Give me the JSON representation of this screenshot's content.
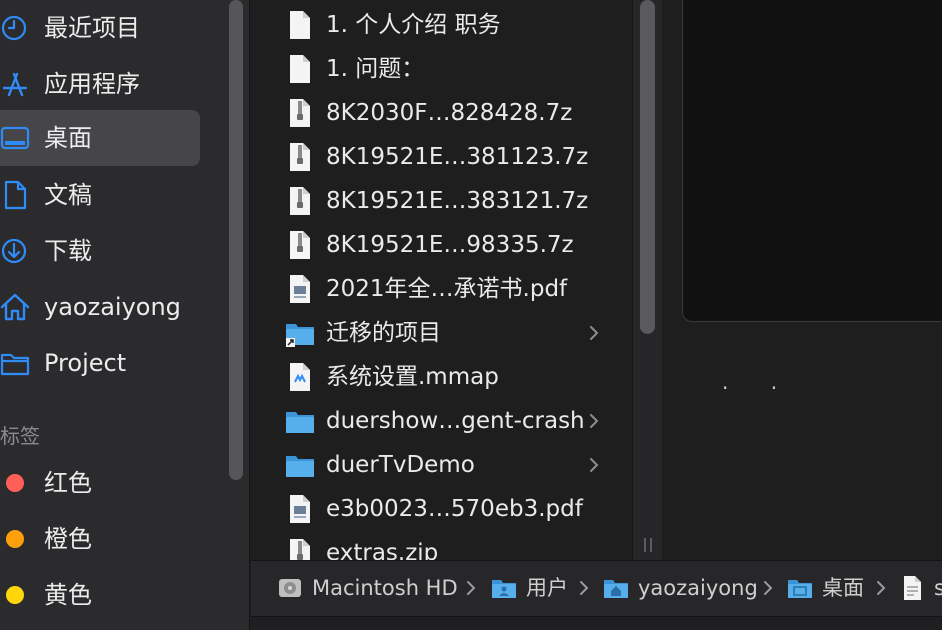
{
  "sidebar": {
    "favorites": [
      {
        "label": "最近项目",
        "icon": "clock-icon"
      },
      {
        "label": "应用程序",
        "icon": "applications-icon"
      },
      {
        "label": "桌面",
        "icon": "desktop-icon",
        "selected": true
      },
      {
        "label": "文稿",
        "icon": "document-icon"
      },
      {
        "label": "下载",
        "icon": "download-icon"
      },
      {
        "label": "yaozaiyong",
        "icon": "home-icon"
      },
      {
        "label": "Project",
        "icon": "folder-icon"
      }
    ],
    "tags_title": "标签",
    "tags": [
      {
        "label": "红色",
        "color": "#ff5f57"
      },
      {
        "label": "橙色",
        "color": "#ff9f0a"
      },
      {
        "label": "黄色",
        "color": "#ffd60a"
      }
    ]
  },
  "files": [
    {
      "name": "1. 个人介绍 职务",
      "icon": "text-file-icon"
    },
    {
      "name": "1. 问题：",
      "icon": "text-file-icon"
    },
    {
      "name": "8K2030F…828428.7z",
      "icon": "archive-file-icon"
    },
    {
      "name": "8K19521E…381123.7z",
      "icon": "archive-file-icon"
    },
    {
      "name": "8K19521E…383121.7z",
      "icon": "archive-file-icon"
    },
    {
      "name": "8K19521E…98335.7z",
      "icon": "archive-file-icon"
    },
    {
      "name": "2021年全…承诺书.pdf",
      "icon": "pdf-file-icon"
    },
    {
      "name": "迁移的项目",
      "icon": "folder-alias-icon",
      "has_children": true
    },
    {
      "name": "系统设置.mmap",
      "icon": "mindmap-file-icon"
    },
    {
      "name": "duershow…gent-crash",
      "icon": "folder-icon",
      "has_children": true
    },
    {
      "name": "duerTvDemo",
      "icon": "folder-icon",
      "has_children": true
    },
    {
      "name": "e3b0023…570eb3.pdf",
      "icon": "pdf-file-icon"
    },
    {
      "name": "extras.zip",
      "icon": "archive-file-icon"
    }
  ],
  "preview": {
    "dots": ". ."
  },
  "pathbar": [
    {
      "label": "Macintosh HD",
      "icon": "hard-drive-icon"
    },
    {
      "label": "用户",
      "icon": "users-folder-icon"
    },
    {
      "label": "yaozaiyong",
      "icon": "home-folder-icon"
    },
    {
      "label": "桌面",
      "icon": "desktop-folder-icon"
    },
    {
      "label": "s",
      "icon": "text-file-icon"
    }
  ],
  "colors": {
    "accent": "#2f8cf7",
    "folder": "#4aa8ea"
  }
}
